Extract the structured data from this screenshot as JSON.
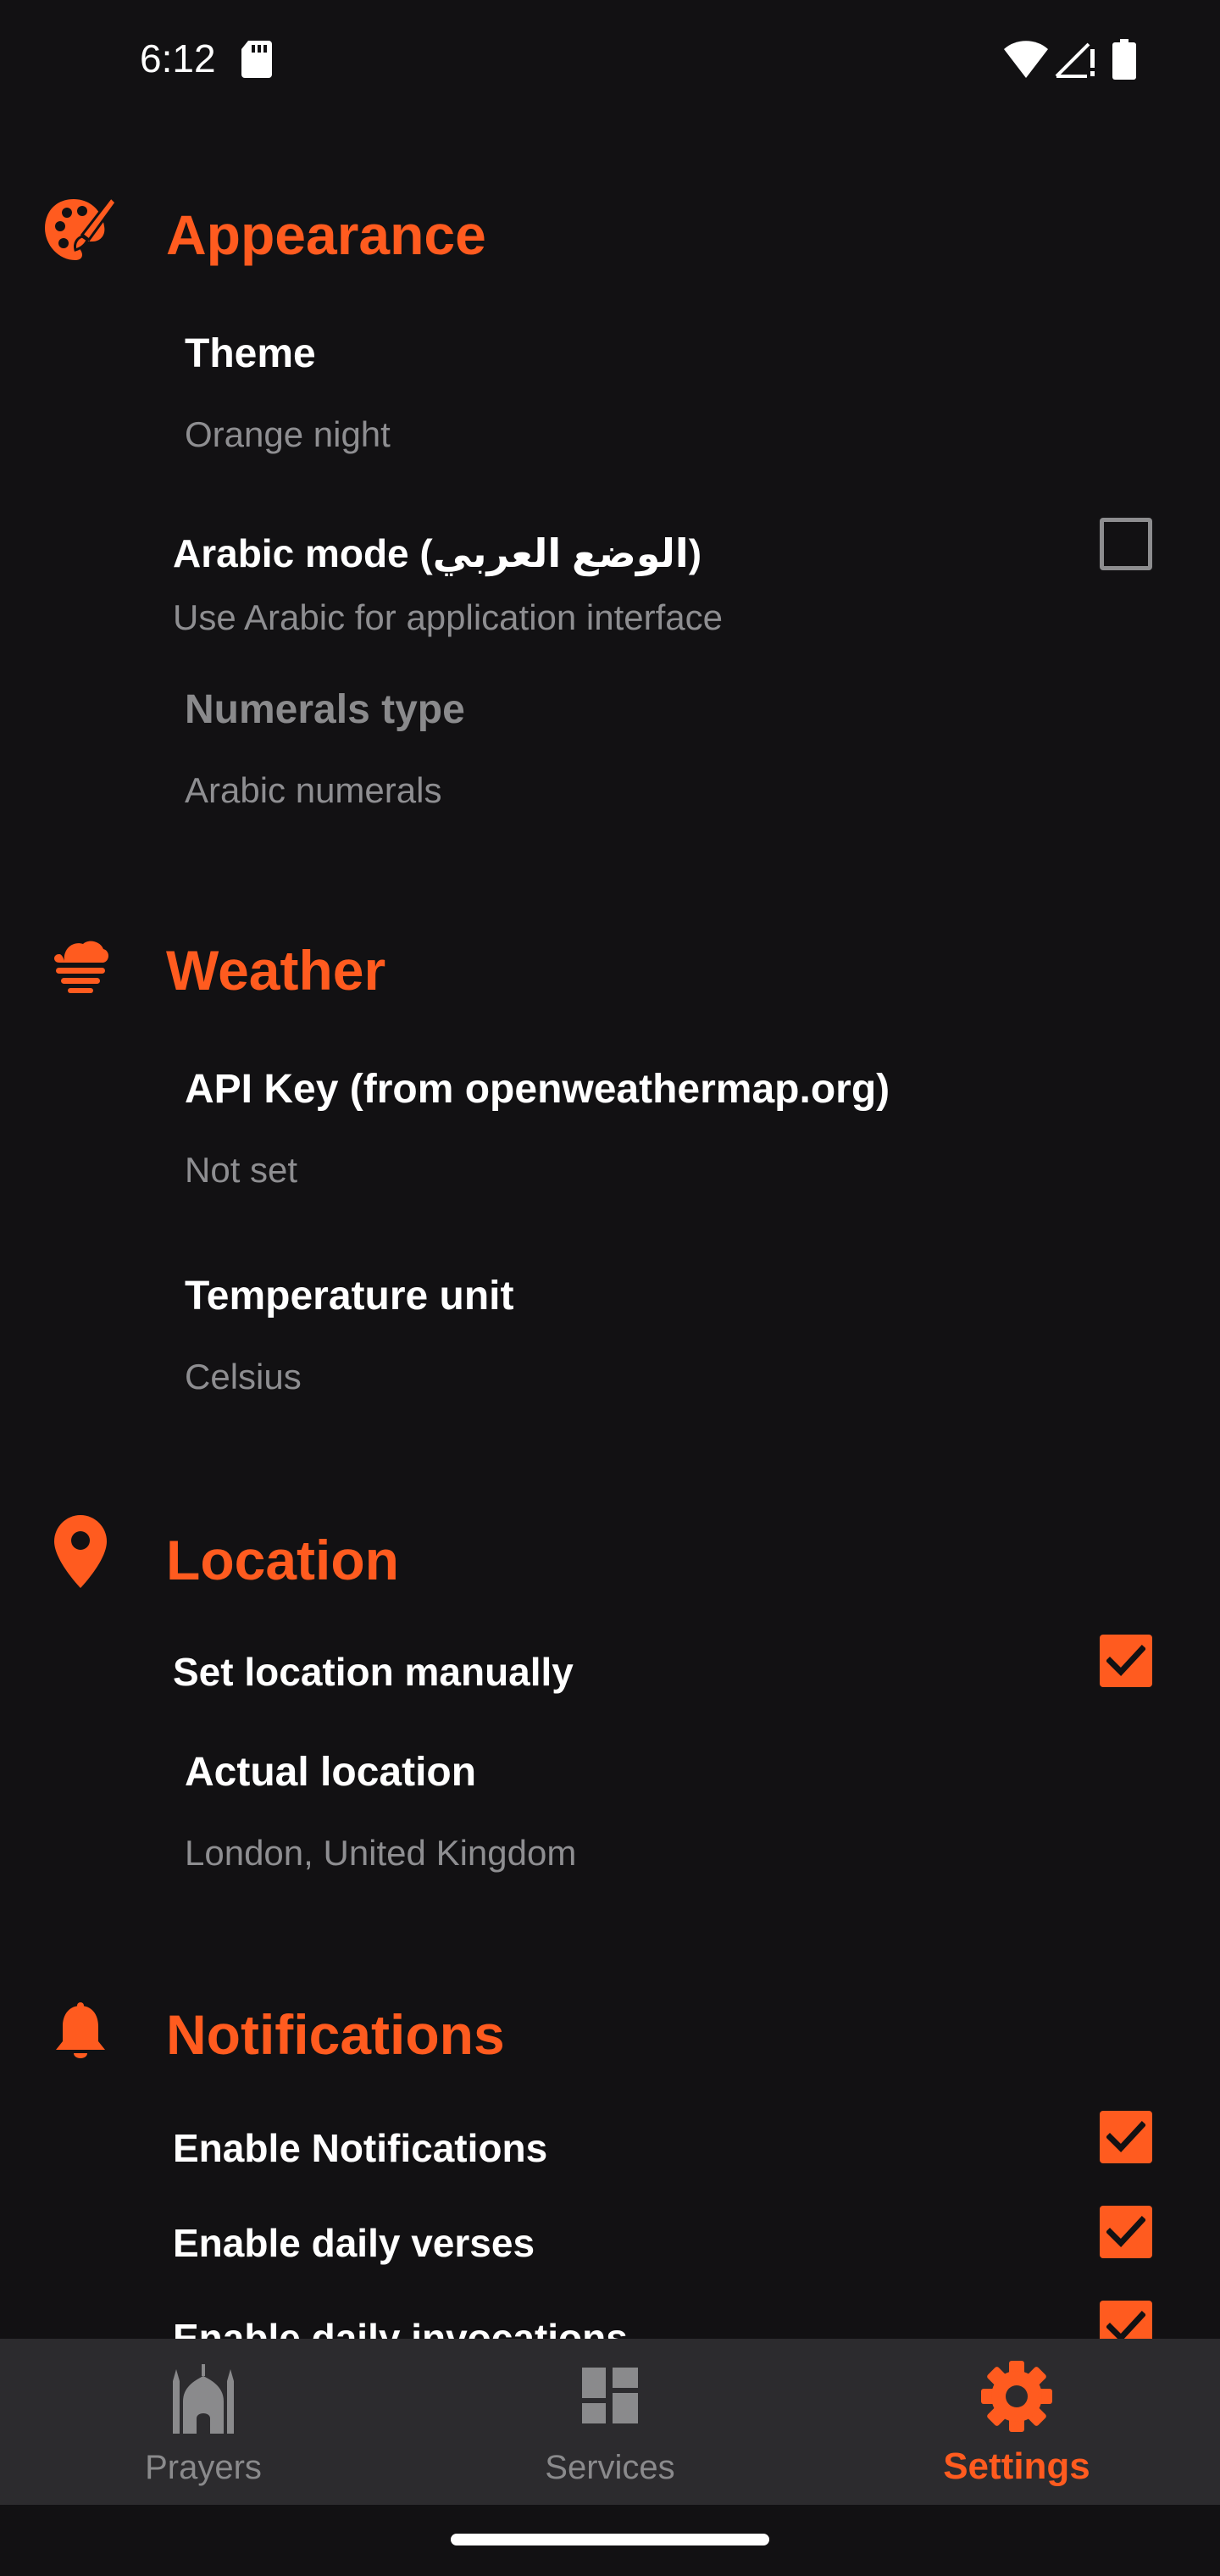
{
  "status_bar": {
    "time": "6:12"
  },
  "colors": {
    "accent": "#ff5b1f",
    "background": "#121113",
    "nav_background": "#2c2b2e",
    "summary_text": "#8e8e91"
  },
  "sections": {
    "appearance": {
      "title": "Appearance",
      "icon": "palette-icon",
      "theme": {
        "title": "Theme",
        "summary": "Orange night"
      },
      "arabic_mode": {
        "title": "Arabic mode (الوضع العربي)",
        "summary": "Use Arabic for application interface",
        "checked": false
      },
      "numerals": {
        "title": "Numerals type",
        "summary": "Arabic numerals",
        "enabled": false
      }
    },
    "weather": {
      "title": "Weather",
      "icon": "weather-cloud-icon",
      "api_key": {
        "title": "API Key (from openweathermap.org)",
        "summary": "Not set"
      },
      "temperature_unit": {
        "title": "Temperature unit",
        "summary": "Celsius"
      }
    },
    "location": {
      "title": "Location",
      "icon": "location-pin-icon",
      "set_manually": {
        "title": "Set location manually",
        "checked": true
      },
      "actual_location": {
        "title": "Actual location",
        "summary": "London, United Kingdom"
      }
    },
    "notifications": {
      "title": "Notifications",
      "icon": "bell-icon",
      "enable_notifications": {
        "title": "Enable Notifications",
        "checked": true
      },
      "daily_verses": {
        "title": "Enable daily verses",
        "checked": true
      },
      "daily_invocations": {
        "title": "Enable daily invocations",
        "checked": true
      }
    }
  },
  "bottom_nav": {
    "items": [
      {
        "label": "Prayers",
        "icon": "mosque-icon",
        "active": false
      },
      {
        "label": "Services",
        "icon": "dashboard-icon",
        "active": false
      },
      {
        "label": "Settings",
        "icon": "gear-icon",
        "active": true
      }
    ]
  }
}
